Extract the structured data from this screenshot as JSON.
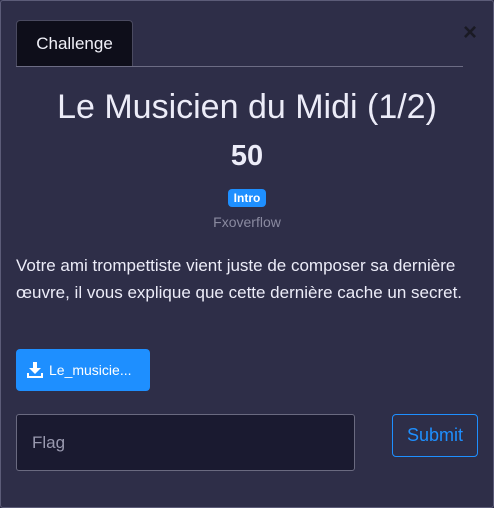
{
  "modal": {
    "close_icon": "close-icon",
    "tab_label": "Challenge"
  },
  "challenge": {
    "title": "Le Musicien du Midi (1/2)",
    "value": "50",
    "tag": "Intro",
    "author": "Fxoverflow",
    "description": "Votre ami trompettiste vient juste de composer sa dernière œuvre, il vous explique que cette dernière cache un secret."
  },
  "file": {
    "icon": "download-icon",
    "label": "Le_musicie..."
  },
  "form": {
    "flag_value": "",
    "flag_placeholder": "Flag",
    "submit_label": "Submit"
  },
  "colors": {
    "background": "#2e2e48",
    "accent": "#1e8fff",
    "tab": "#0e0e1a",
    "input": "#1a1a30"
  }
}
